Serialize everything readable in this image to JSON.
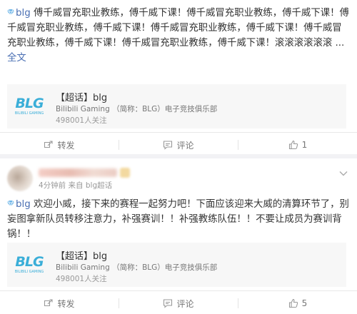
{
  "post1": {
    "hashtag": "blg",
    "body": "傅千威冒充职业教练，傅千威下课！傅千威冒充职业教练，傅千威下课！傅千威冒充职业教练，傅千威下课！傅千威冒充职业教练，傅千威下课！傅千威冒充职业教练，傅千威下课！傅千威冒充职业教练，傅千威下课！滚滚滚滚滚滚",
    "ellipsis": " ...",
    "more": "全文",
    "topic": {
      "title": "【超话】blg",
      "desc": "Bilibili Gaming （简称：BLG）电子竞技俱乐部",
      "followers": "498001人关注"
    },
    "actions": {
      "repost": "转发",
      "comment": "评论",
      "like": "1"
    }
  },
  "post2": {
    "meta_time": "4分钟前",
    "meta_from": "来自",
    "meta_source": "blg超话",
    "hashtag": "blg",
    "body": " 欢迎小威，接下来的赛程一起努力吧！下面应该迎来大威的清算环节了，别妄图拿新队员转移注意力，补强赛训！！补强教练队伍！！不要让成员为赛训背锅！！",
    "topic": {
      "title": "【超话】blg",
      "desc": "Bilibili Gaming （简称：BLG）电子竞技俱乐部",
      "followers": "498001人关注"
    },
    "actions": {
      "repost": "转发",
      "comment": "评论",
      "like": "5"
    }
  },
  "icons": [
    "gem-icon",
    "repost-icon",
    "comment-icon",
    "like-icon",
    "chevron-down-icon",
    "blg-logo"
  ],
  "colors": {
    "link": "#4a6fb3",
    "logo": "#3aaed8",
    "background": "#f2f2f5"
  }
}
